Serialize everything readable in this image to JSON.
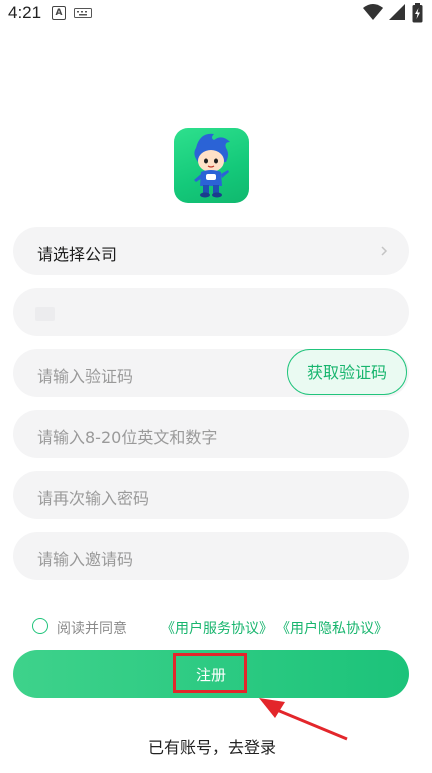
{
  "status_bar": {
    "time": "4:21",
    "notification_icon_letter": "A",
    "icons": [
      "a-notification-icon",
      "keyboard-icon",
      "wifi-icon",
      "signal-icon",
      "battery-charging-icon"
    ]
  },
  "logo": {
    "icon": "mascot-app-logo"
  },
  "form": {
    "company_select": {
      "label": "请选择公司"
    },
    "phone_field": {
      "value": ""
    },
    "code_field": {
      "placeholder": "请输入验证码"
    },
    "get_code_button": "获取验证码",
    "password_field": {
      "placeholder": "请输入8-20位英文和数字"
    },
    "confirm_password_field": {
      "placeholder": "请再次输入密码"
    },
    "invite_code_field": {
      "placeholder": "请输入邀请码"
    }
  },
  "agreement": {
    "text": "阅读并同意",
    "link_service": "《用户服务协议》",
    "link_privacy": "《用户隐私协议》",
    "checked": false
  },
  "register_button": "注册",
  "login_link": "已有账号，去登录",
  "colors": {
    "brand_green": "#1cc37a",
    "field_bg": "#f4f4f5",
    "annotation_red": "#e3262b"
  }
}
